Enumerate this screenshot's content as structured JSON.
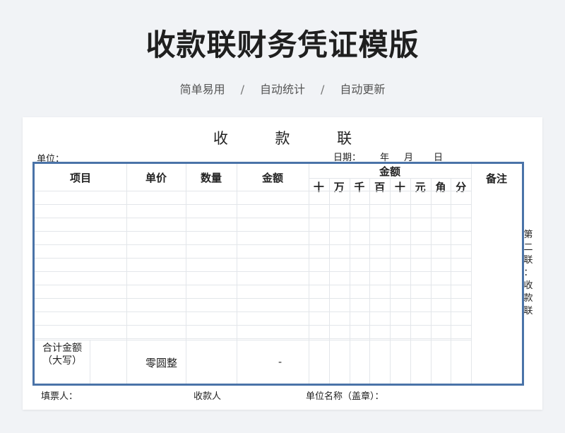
{
  "header": {
    "title": "收款联财务凭证模版",
    "tags": [
      "简单易用",
      "自动统计",
      "自动更新"
    ],
    "separator": "/"
  },
  "document": {
    "title": "收 款 联",
    "unit_label": "单位：",
    "date_label": "日期：",
    "year_label": "年",
    "month_label": "月",
    "day_label": "日",
    "columns": {
      "item": "项目",
      "unit_price": "单价",
      "quantity": "数量",
      "amount": "金额",
      "amount_group": "金额",
      "digits": [
        "十",
        "万",
        "千",
        "百",
        "十",
        "元",
        "角",
        "分"
      ],
      "remarks": "备注"
    },
    "empty_rows": 11,
    "total": {
      "label": "合计金额（大写）",
      "uppercase_amount": "零圆整",
      "amount": "-"
    },
    "side_label": [
      "第",
      "二",
      "联",
      "：",
      "收",
      "款",
      "联"
    ],
    "footer": {
      "filler": "填票人：",
      "payee": "收款人",
      "unit_name": "单位名称（盖章）："
    }
  }
}
